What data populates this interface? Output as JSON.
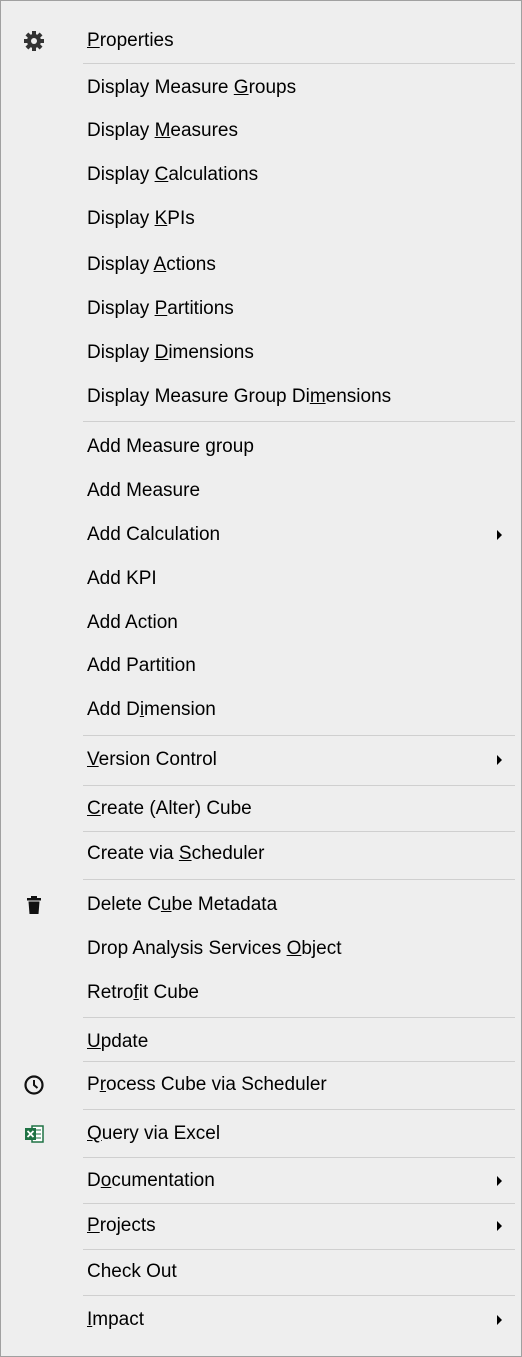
{
  "menu": {
    "items": [
      {
        "pre": "",
        "acc": "P",
        "post": "roperties",
        "icon": "gear-icon",
        "arrow": false
      },
      {
        "pre": "Display Measure ",
        "acc": "G",
        "post": "roups",
        "icon": "",
        "arrow": false
      },
      {
        "pre": "Display ",
        "acc": "M",
        "post": "easures",
        "icon": "",
        "arrow": false
      },
      {
        "pre": "Display ",
        "acc": "C",
        "post": "alculations",
        "icon": "",
        "arrow": false
      },
      {
        "pre": "Display ",
        "acc": "K",
        "post": "PIs",
        "icon": "",
        "arrow": false
      },
      {
        "pre": "Display ",
        "acc": "A",
        "post": "ctions",
        "icon": "",
        "arrow": false
      },
      {
        "pre": "Display ",
        "acc": "P",
        "post": "artitions",
        "icon": "",
        "arrow": false
      },
      {
        "pre": "Display ",
        "acc": "D",
        "post": "imensions",
        "icon": "",
        "arrow": false
      },
      {
        "pre": "Display Measure Group Di",
        "acc": "m",
        "post": "ensions",
        "icon": "",
        "arrow": false
      },
      {
        "pre": "Add Measure group",
        "acc": "",
        "post": "",
        "icon": "",
        "arrow": false
      },
      {
        "pre": "Add Measure",
        "acc": "",
        "post": "",
        "icon": "",
        "arrow": false
      },
      {
        "pre": "Add Calculation",
        "acc": "",
        "post": "",
        "icon": "",
        "arrow": true
      },
      {
        "pre": "Add KPI",
        "acc": "",
        "post": "",
        "icon": "",
        "arrow": false
      },
      {
        "pre": "Add Action",
        "acc": "",
        "post": "",
        "icon": "",
        "arrow": false
      },
      {
        "pre": "Add Partition",
        "acc": "",
        "post": "",
        "icon": "",
        "arrow": false
      },
      {
        "pre": "Add D",
        "acc": "i",
        "post": "mension",
        "icon": "",
        "arrow": false
      },
      {
        "pre": "",
        "acc": "V",
        "post": "ersion Control",
        "icon": "",
        "arrow": true
      },
      {
        "pre": "",
        "acc": "C",
        "post": "reate (Alter) Cube",
        "icon": "",
        "arrow": false
      },
      {
        "pre": "Create via ",
        "acc": "S",
        "post": "cheduler",
        "icon": "",
        "arrow": false
      },
      {
        "pre": "Delete C",
        "acc": "u",
        "post": "be Metadata",
        "icon": "trash-icon",
        "arrow": false
      },
      {
        "pre": "Drop Analysis Services ",
        "acc": "O",
        "post": "bject",
        "icon": "",
        "arrow": false
      },
      {
        "pre": "Retro",
        "acc": "f",
        "post": "it Cube",
        "icon": "",
        "arrow": false
      },
      {
        "pre": "",
        "acc": "U",
        "post": "pdate",
        "icon": "",
        "arrow": false
      },
      {
        "pre": "P",
        "acc": "r",
        "post": "ocess Cube via Scheduler",
        "icon": "clock-icon",
        "arrow": false
      },
      {
        "pre": "",
        "acc": "Q",
        "post": "uery via Excel",
        "icon": "excel-icon",
        "arrow": false
      },
      {
        "pre": "D",
        "acc": "o",
        "post": "cumentation",
        "icon": "",
        "arrow": true
      },
      {
        "pre": "",
        "acc": "P",
        "post": "rojects",
        "icon": "",
        "arrow": true
      },
      {
        "pre": "Check Out",
        "acc": "",
        "post": "",
        "icon": "",
        "arrow": false
      },
      {
        "pre": "",
        "acc": "I",
        "post": "mpact",
        "icon": "",
        "arrow": true
      }
    ]
  }
}
